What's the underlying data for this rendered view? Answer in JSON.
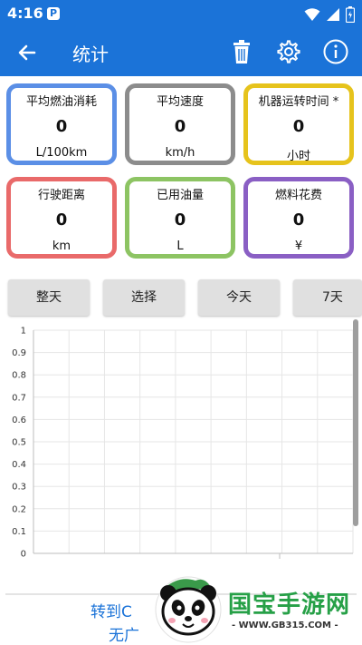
{
  "status_bar": {
    "time": "4:16",
    "badge": "P"
  },
  "app_bar": {
    "title": "统计"
  },
  "stats": [
    {
      "label": "平均燃油消耗",
      "value": "0",
      "unit": "L/100km",
      "color": "#5b8fe6"
    },
    {
      "label": "平均速度",
      "value": "0",
      "unit": "km/h",
      "color": "#8c8c8c"
    },
    {
      "label": "机器运转时间 *",
      "value": "0",
      "unit": "小时",
      "color": "#e6c31c"
    },
    {
      "label": "行驶距离",
      "value": "0",
      "unit": "km",
      "color": "#e96a6a"
    },
    {
      "label": "已用油量",
      "value": "0",
      "unit": "L",
      "color": "#8dc463"
    },
    {
      "label": "燃料花费",
      "value": "0",
      "unit": "¥",
      "color": "#8a5fc4"
    }
  ],
  "periods": [
    "整天",
    "选择",
    "今天",
    "7天"
  ],
  "chart": {
    "y_ticks": [
      "1",
      "0.9",
      "0.8",
      "0.7",
      "0.6",
      "0.5",
      "0.4",
      "0.3",
      "0.2",
      "0.1",
      "0"
    ]
  },
  "footer": {
    "line1": "转到C",
    "line2": "无广"
  },
  "watermark": {
    "brand": "国宝手游网",
    "url": "- WWW.GB315.COM -"
  },
  "colors": {
    "primary": "#1b73d8",
    "button_bg": "#e0e0e0",
    "grid": "#e6e6e6",
    "watermark_green": "#26a047"
  }
}
